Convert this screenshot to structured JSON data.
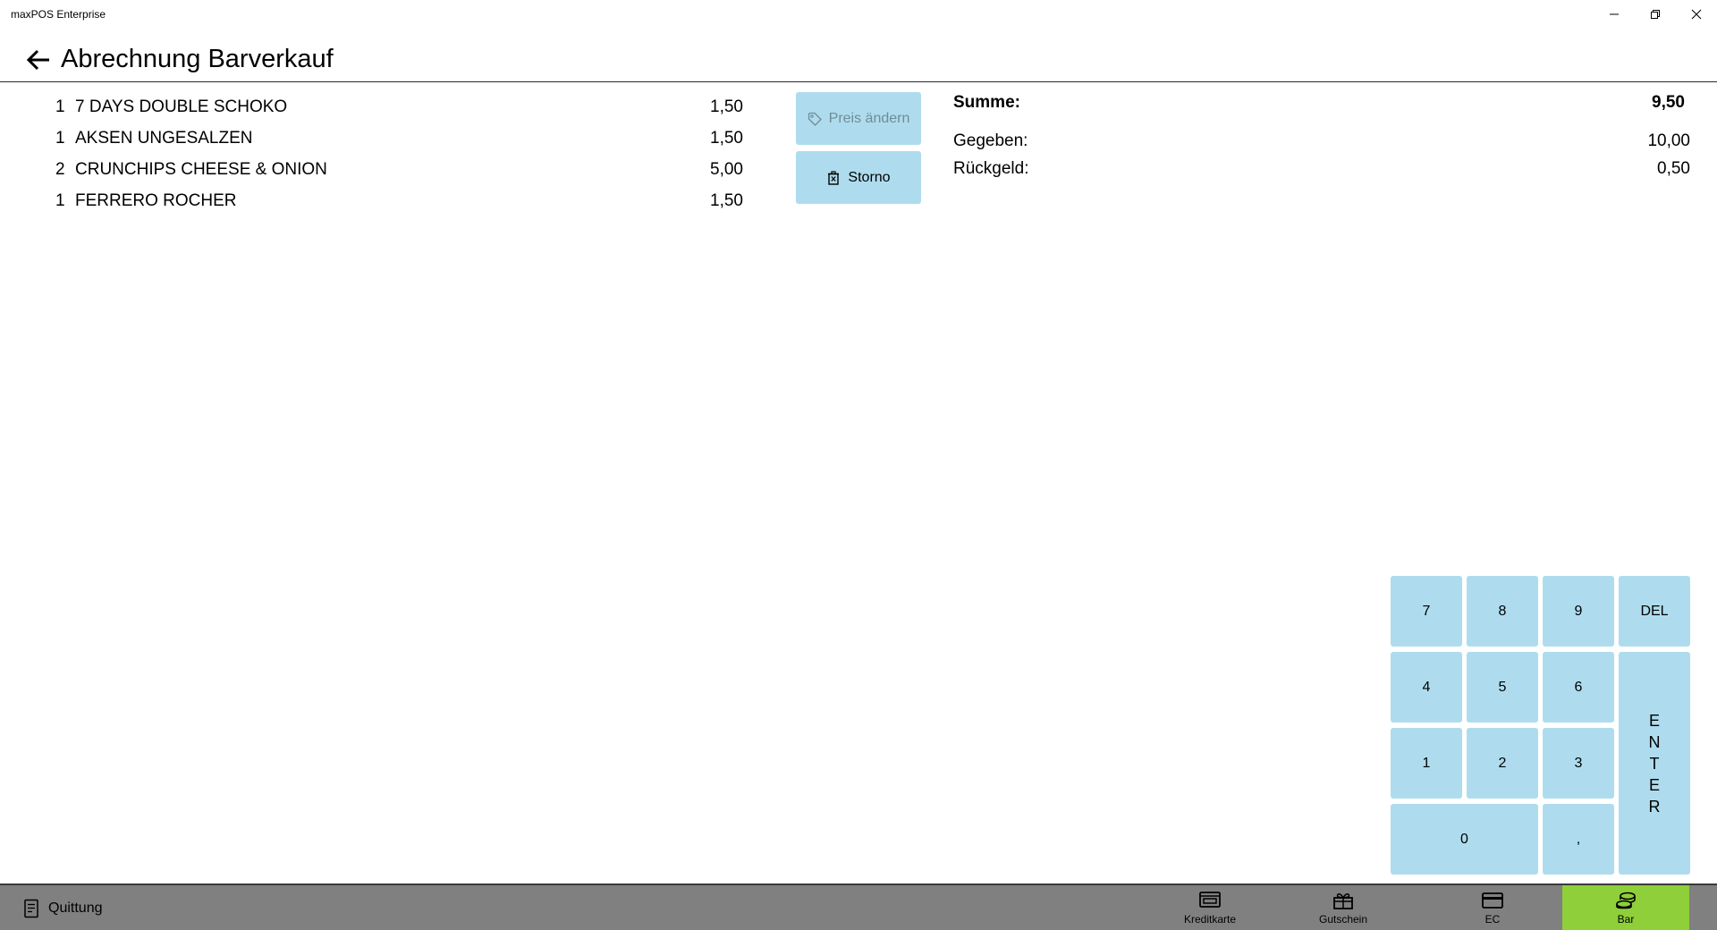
{
  "window": {
    "title": "maxPOS Enterprise",
    "minimize_icon": "minimize-icon",
    "maximize_icon": "restore-icon",
    "close_icon": "close-icon"
  },
  "header": {
    "back_icon": "arrow-left-icon",
    "title": "Abrechnung Barverkauf"
  },
  "items": [
    {
      "qty": "1",
      "name": "7 DAYS DOUBLE SCHOKO",
      "price": "1,50"
    },
    {
      "qty": "1",
      "name": "AKSEN UNGESALZEN",
      "price": "1,50"
    },
    {
      "qty": "2",
      "name": "CRUNCHIPS CHEESE & ONION",
      "price": "5,00"
    },
    {
      "qty": "1",
      "name": "FERRERO ROCHER",
      "price": "1,50"
    }
  ],
  "actions": {
    "price_change": {
      "label": "Preis ändern",
      "icon": "tag-icon",
      "enabled": false
    },
    "storno": {
      "label": "Storno",
      "icon": "delete-icon",
      "enabled": true
    }
  },
  "summary": {
    "total_label": "Summe:",
    "total_value": "9,50",
    "given_label": "Gegeben:",
    "given_value": "10,00",
    "change_label": "Rückgeld:",
    "change_value": "0,50"
  },
  "keypad": {
    "k7": "7",
    "k8": "8",
    "k9": "9",
    "del": "DEL",
    "k4": "4",
    "k5": "5",
    "k6": "6",
    "k1": "1",
    "k2": "2",
    "k3": "3",
    "k0": "0",
    "comma": ",",
    "enter": [
      "E",
      "N",
      "T",
      "E",
      "R"
    ]
  },
  "bottom": {
    "receipt_label": "Quittung",
    "receipt_icon": "receipt-icon",
    "payments": [
      {
        "label": "Kreditkarte",
        "icon": "credit-card-icon",
        "active": false
      },
      {
        "label": "Gutschein",
        "icon": "gift-icon",
        "active": false
      },
      {
        "label": "EC",
        "icon": "card-icon",
        "active": false
      },
      {
        "label": "Bar",
        "icon": "cash-icon",
        "active": true
      }
    ]
  },
  "colors": {
    "button_bg": "#aedcee",
    "bottom_bar": "#808080",
    "active_payment": "#8ecf3a",
    "disabled_text": "#6f8c98"
  }
}
